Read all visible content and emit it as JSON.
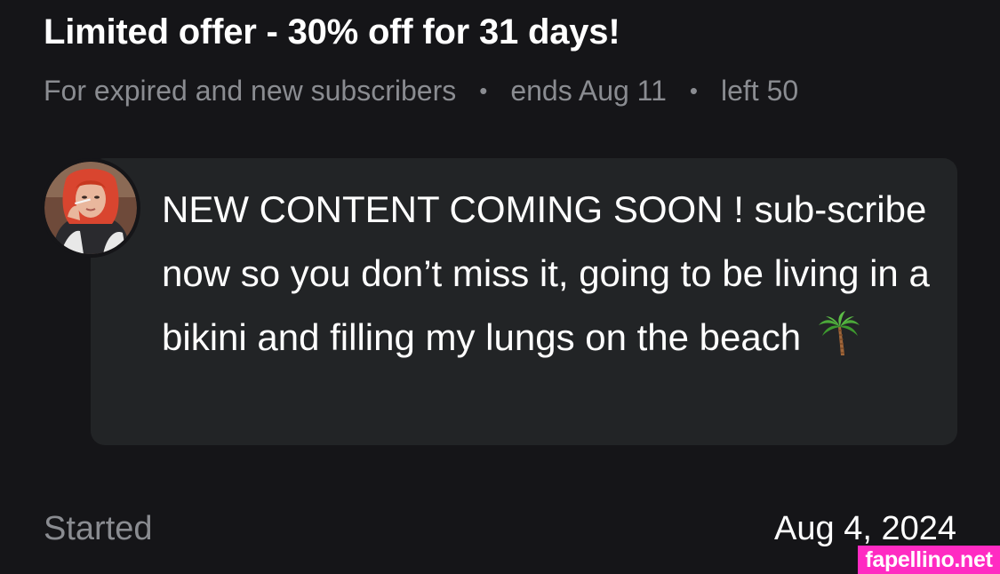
{
  "offer": {
    "title": "Limited offer - 30% off for 31 days!",
    "audience": "For expired and new subscribers",
    "ends": "ends Aug 11",
    "left": "left 50",
    "separator": "•"
  },
  "message": {
    "text": "NEW CONTENT COMING SOON ! sub-scribe now so you don’t miss it, going to be living in a bikini and filling my lungs on the beach",
    "emoji_icon": "palm-tree-icon",
    "bubble_color": "#222426"
  },
  "footer": {
    "started_label": "Started",
    "started_date": "Aug 4, 2024"
  },
  "watermark": {
    "text": "fapellino.net",
    "color": "#ff2bc2"
  },
  "colors": {
    "background": "#151518",
    "primary_text": "#ffffff",
    "secondary_text": "#8a8c91"
  }
}
